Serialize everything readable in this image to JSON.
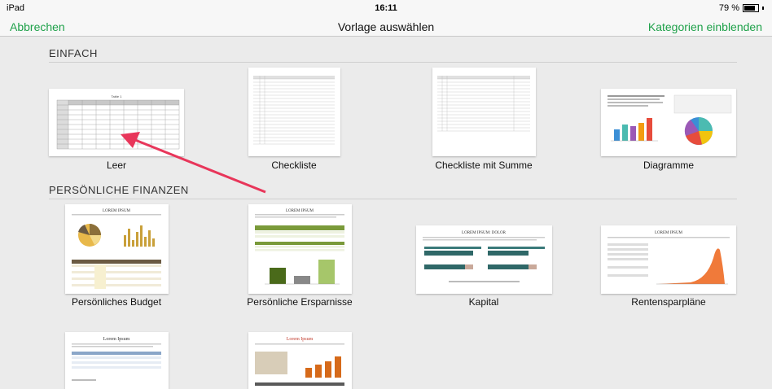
{
  "status": {
    "device": "iPad",
    "time": "16:11",
    "battery": "79 %"
  },
  "nav": {
    "cancel": "Abbrechen",
    "title": "Vorlage auswählen",
    "categories": "Kategorien einblenden"
  },
  "sections": {
    "basic": {
      "title": "EINFACH",
      "templates": [
        "Leer",
        "Checkliste",
        "Checkliste mit Summe",
        "Diagramme"
      ]
    },
    "finance": {
      "title": "PERSÖNLICHE FINANZEN",
      "templates": [
        "Persönliches Budget",
        "Persönliche Ersparnisse",
        "Kapital",
        "Rentensparpläne"
      ]
    }
  },
  "thumbnail_text": {
    "leer_title": "Table 1",
    "budget_title": "LOREM IPSUM",
    "savings_title": "LOREM IPSUM",
    "kapital_title": "LOREM IPSUM: DOLOR",
    "rente_title": "LOREM IPSUM",
    "row3a_title": "Lorem Ipsum",
    "row3b_title": "Lorem Ipsum"
  },
  "colors": {
    "accent": "#1fa14a",
    "arrow": "#e8365a",
    "background": "#ebebeb"
  }
}
